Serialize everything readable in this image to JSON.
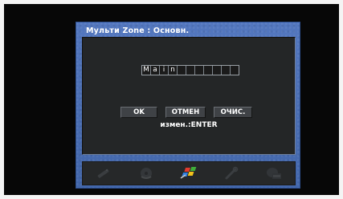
{
  "osd": {
    "title": "Мульти Zone : Основн.",
    "name_chars": [
      "M",
      "a",
      "i",
      "n",
      "",
      "",
      "",
      "",
      "",
      "",
      ""
    ],
    "buttons": {
      "ok": "OK",
      "cancel": "ОТМЕН",
      "clear": "ОЧИС."
    },
    "hint": "измен.:ENTER"
  },
  "toolbar": {
    "icons": [
      "remote-icon",
      "disc-icon",
      "windows-setup-icon",
      "tools-icon",
      "abc-language-icon"
    ],
    "active_icon": "windows-setup-icon"
  },
  "colors": {
    "frame_blue": "#4a71b9",
    "panel_dark": "#242627",
    "screen_black": "#070707"
  }
}
